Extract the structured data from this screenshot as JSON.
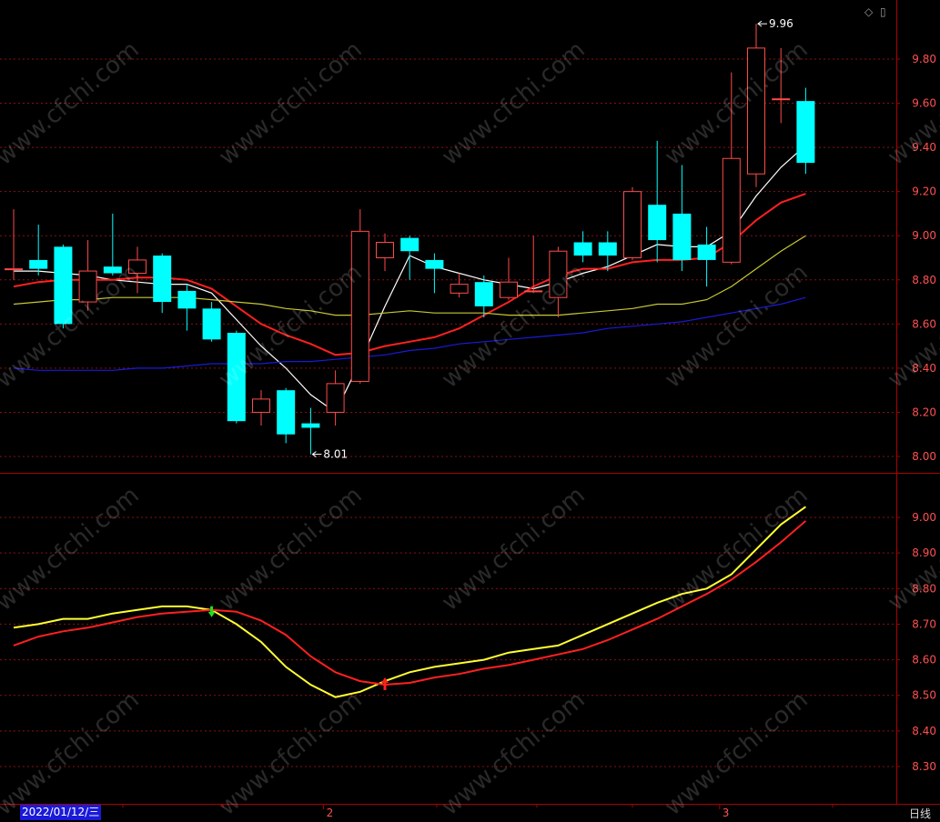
{
  "chart_data": [
    {
      "type": "candlestick",
      "title": "",
      "ylim": [
        7.93,
        10.0
      ],
      "y_ticks": [
        "8.00",
        "8.20",
        "8.40",
        "8.60",
        "8.80",
        "9.00",
        "9.20",
        "9.40",
        "9.60",
        "9.80"
      ],
      "x_ticks": [
        {
          "index": 13,
          "label": "2"
        },
        {
          "index": 29,
          "label": "3"
        }
      ],
      "grid": true,
      "annotations": [
        {
          "index": 12,
          "value": 8.01,
          "label": "8.01"
        },
        {
          "index": 30,
          "value": 9.96,
          "label": "9.96"
        }
      ],
      "candles": [
        {
          "o": 8.85,
          "h": 9.12,
          "l": 8.8,
          "c": 8.85
        },
        {
          "o": 8.89,
          "h": 9.05,
          "l": 8.82,
          "c": 8.85
        },
        {
          "o": 8.95,
          "h": 8.96,
          "l": 8.58,
          "c": 8.6
        },
        {
          "o": 8.7,
          "h": 8.98,
          "l": 8.66,
          "c": 8.84
        },
        {
          "o": 8.86,
          "h": 9.1,
          "l": 8.82,
          "c": 8.83
        },
        {
          "o": 8.83,
          "h": 8.95,
          "l": 8.74,
          "c": 8.89
        },
        {
          "o": 8.91,
          "h": 8.92,
          "l": 8.65,
          "c": 8.7
        },
        {
          "o": 8.75,
          "h": 8.78,
          "l": 8.57,
          "c": 8.67
        },
        {
          "o": 8.67,
          "h": 8.7,
          "l": 8.52,
          "c": 8.53
        },
        {
          "o": 8.56,
          "h": 8.57,
          "l": 8.15,
          "c": 8.16
        },
        {
          "o": 8.2,
          "h": 8.3,
          "l": 8.14,
          "c": 8.26
        },
        {
          "o": 8.3,
          "h": 8.31,
          "l": 8.06,
          "c": 8.1
        },
        {
          "o": 8.15,
          "h": 8.22,
          "l": 8.01,
          "c": 8.13
        },
        {
          "o": 8.2,
          "h": 8.39,
          "l": 8.14,
          "c": 8.33
        },
        {
          "o": 8.34,
          "h": 9.12,
          "l": 8.33,
          "c": 9.02
        },
        {
          "o": 8.9,
          "h": 9.01,
          "l": 8.84,
          "c": 8.97
        },
        {
          "o": 8.99,
          "h": 9.0,
          "l": 8.8,
          "c": 8.93
        },
        {
          "o": 8.89,
          "h": 8.92,
          "l": 8.74,
          "c": 8.85
        },
        {
          "o": 8.74,
          "h": 8.83,
          "l": 8.72,
          "c": 8.78
        },
        {
          "o": 8.79,
          "h": 8.82,
          "l": 8.63,
          "c": 8.68
        },
        {
          "o": 8.72,
          "h": 8.9,
          "l": 8.71,
          "c": 8.79
        },
        {
          "o": 8.75,
          "h": 9.0,
          "l": 8.74,
          "c": 8.75
        },
        {
          "o": 8.72,
          "h": 8.95,
          "l": 8.63,
          "c": 8.93
        },
        {
          "o": 8.97,
          "h": 9.02,
          "l": 8.88,
          "c": 8.91
        },
        {
          "o": 8.97,
          "h": 9.02,
          "l": 8.84,
          "c": 8.91
        },
        {
          "o": 8.9,
          "h": 9.22,
          "l": 8.89,
          "c": 9.2
        },
        {
          "o": 9.14,
          "h": 9.43,
          "l": 8.88,
          "c": 8.98
        },
        {
          "o": 9.1,
          "h": 9.32,
          "l": 8.84,
          "c": 8.89
        },
        {
          "o": 8.96,
          "h": 9.04,
          "l": 8.77,
          "c": 8.89
        },
        {
          "o": 8.88,
          "h": 9.74,
          "l": 8.87,
          "c": 9.35
        },
        {
          "o": 9.28,
          "h": 9.96,
          "l": 9.22,
          "c": 9.85
        },
        {
          "o": 9.62,
          "h": 9.85,
          "l": 9.51,
          "c": 9.62
        },
        {
          "o": 9.61,
          "h": 9.67,
          "l": 9.28,
          "c": 9.33
        }
      ],
      "series": [
        {
          "color": "#ffffff",
          "values": [
            8.84,
            8.84,
            8.83,
            8.82,
            8.8,
            8.79,
            8.78,
            8.78,
            8.74,
            8.62,
            8.5,
            8.4,
            8.28,
            8.2,
            8.43,
            8.68,
            8.91,
            8.86,
            8.83,
            8.8,
            8.78,
            8.76,
            8.79,
            8.83,
            8.86,
            8.91,
            8.96,
            8.95,
            8.95,
            9.02,
            9.18,
            9.31,
            9.41
          ]
        },
        {
          "color": "#ff2020",
          "values": [
            8.77,
            8.79,
            8.8,
            8.8,
            8.8,
            8.81,
            8.81,
            8.8,
            8.76,
            8.68,
            8.6,
            8.55,
            8.51,
            8.46,
            8.47,
            8.5,
            8.52,
            8.54,
            8.58,
            8.64,
            8.7,
            8.77,
            8.82,
            8.85,
            8.85,
            8.88,
            8.89,
            8.89,
            8.9,
            8.97,
            9.07,
            9.15,
            9.19
          ]
        },
        {
          "color": "#c8c832",
          "values": [
            8.69,
            8.7,
            8.71,
            8.71,
            8.72,
            8.72,
            8.72,
            8.72,
            8.71,
            8.7,
            8.69,
            8.67,
            8.66,
            8.64,
            8.64,
            8.65,
            8.66,
            8.65,
            8.65,
            8.65,
            8.64,
            8.64,
            8.64,
            8.65,
            8.66,
            8.67,
            8.69,
            8.69,
            8.71,
            8.77,
            8.85,
            8.93,
            9.0
          ]
        },
        {
          "color": "#1a1ad8",
          "values": [
            8.4,
            8.39,
            8.39,
            8.39,
            8.39,
            8.4,
            8.4,
            8.41,
            8.42,
            8.42,
            8.42,
            8.43,
            8.43,
            8.44,
            8.45,
            8.46,
            8.48,
            8.49,
            8.51,
            8.52,
            8.53,
            8.54,
            8.55,
            8.56,
            8.58,
            8.59,
            8.6,
            8.61,
            8.63,
            8.65,
            8.67,
            8.69,
            8.72
          ]
        }
      ]
    },
    {
      "type": "line",
      "title": "",
      "ylim": [
        8.25,
        9.08
      ],
      "y_ticks": [
        "8.30",
        "8.40",
        "8.50",
        "8.60",
        "8.70",
        "8.80",
        "8.90",
        "9.00"
      ],
      "grid": true,
      "series": [
        {
          "color": "#ffff30",
          "values": [
            8.69,
            8.7,
            8.715,
            8.715,
            8.73,
            8.74,
            8.75,
            8.75,
            8.74,
            8.7,
            8.65,
            8.58,
            8.53,
            8.495,
            8.51,
            8.54,
            8.565,
            8.58,
            8.59,
            8.6,
            8.62,
            8.63,
            8.64,
            8.67,
            8.7,
            8.73,
            8.76,
            8.785,
            8.8,
            8.84,
            8.91,
            8.98,
            9.03
          ]
        },
        {
          "color": "#ff2020",
          "values": [
            8.64,
            8.665,
            8.68,
            8.69,
            8.705,
            8.72,
            8.73,
            8.735,
            8.74,
            8.735,
            8.71,
            8.67,
            8.61,
            8.565,
            8.54,
            8.53,
            8.535,
            8.55,
            8.56,
            8.575,
            8.585,
            8.6,
            8.615,
            8.63,
            8.655,
            8.685,
            8.715,
            8.75,
            8.785,
            8.825,
            8.875,
            8.93,
            8.99
          ]
        }
      ],
      "signals": [
        {
          "index": 8,
          "direction": "down",
          "color": "#20e020"
        },
        {
          "index": 15,
          "direction": "up",
          "color": "#ff2020"
        }
      ]
    }
  ],
  "footer": {
    "date": "2022/01/12/三",
    "period": "日线"
  },
  "window_icons": [
    "diamond-icon",
    "restore-icon"
  ],
  "watermark": "www.cfchi.com",
  "colors": {
    "up": "#ff4a4a",
    "down": "#00ffff",
    "axis": "#aa0000",
    "grid": "#8a1010",
    "tick_text": "#ff5050"
  }
}
